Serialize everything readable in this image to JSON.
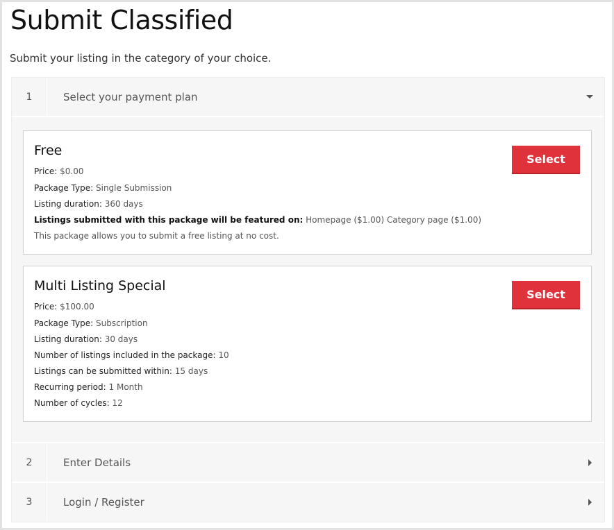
{
  "page": {
    "title": "Submit Classified",
    "subtitle": "Submit your listing in the category of your choice."
  },
  "steps": [
    {
      "number": "1",
      "label": "Select your payment plan",
      "state": "expanded"
    },
    {
      "number": "2",
      "label": "Enter Details",
      "state": "collapsed"
    },
    {
      "number": "3",
      "label": "Login / Register",
      "state": "collapsed"
    }
  ],
  "plans": [
    {
      "name": "Free",
      "button": "Select",
      "price_key": "Price:",
      "price": "$0.00",
      "type_key": "Package Type:",
      "type": "Single Submission",
      "duration_key": "Listing duration:",
      "duration": "360 days",
      "featured_key": "Listings submitted with this package will be featured on:",
      "featured": "Homepage ($1.00) Category page ($1.00)",
      "description": "This package allows you to submit a free listing at no cost."
    },
    {
      "name": "Multi Listing Special",
      "button": "Select",
      "price_key": "Price:",
      "price": "$100.00",
      "type_key": "Package Type:",
      "type": "Subscription",
      "duration_key": "Listing duration:",
      "duration": "30 days",
      "listings_key": "Number of listings included in the package:",
      "listings": "10",
      "within_key": "Listings can be submitted within:",
      "within": "15 days",
      "recurring_key": "Recurring period:",
      "recurring": "1 Month",
      "cycles_key": "Number of cycles:",
      "cycles": "12"
    }
  ],
  "colors": {
    "accent": "#e0323a",
    "panel_bg": "#f6f6f6",
    "border": "#cfcfcf"
  },
  "icons": {
    "expanded": "caret-down-icon",
    "collapsed": "caret-right-icon"
  }
}
